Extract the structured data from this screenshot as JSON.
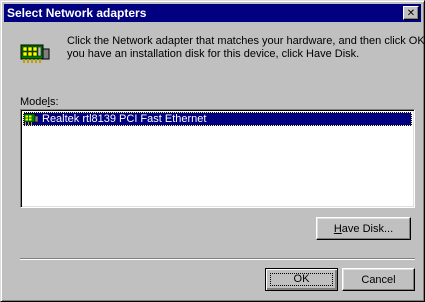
{
  "window": {
    "title": "Select Network adapters",
    "close_symbol": "✕"
  },
  "instructions": {
    "line1": "Click the Network adapter that matches your hardware, and then click OK. If",
    "line2": "you have an installation disk for this device, click Have Disk."
  },
  "models": {
    "label_pre": "Mode",
    "label_mnemonic": "l",
    "label_post": "s:",
    "items": [
      {
        "label": "Realtek rtl8139 PCI Fast Ethernet",
        "selected": true,
        "icon": "network-card-icon"
      }
    ]
  },
  "buttons": {
    "have_disk_mnemonic": "H",
    "have_disk_rest": "ave Disk...",
    "ok": "OK",
    "cancel": "Cancel"
  },
  "icons": {
    "header": "network-hardware-icon",
    "close": "close-icon"
  },
  "colors": {
    "titlebar": "#000080",
    "face": "#c0c0c0",
    "selection": "#000080"
  }
}
